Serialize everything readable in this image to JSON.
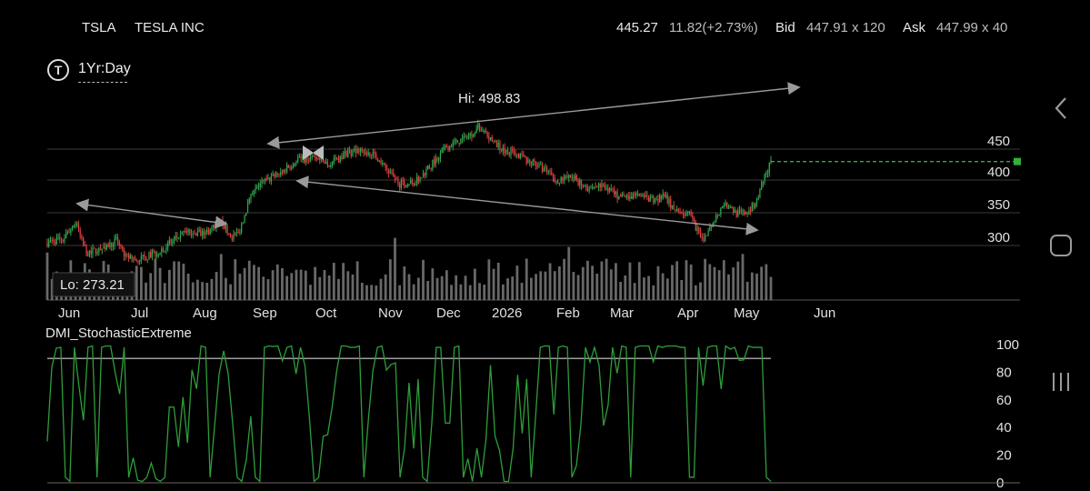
{
  "header": {
    "symbol": "TSLA",
    "company": "TESLA INC",
    "last": "445.27",
    "change": "11.82(+2.73%)",
    "bid_label": "Bid",
    "bid": "447.91 x 120",
    "ask_label": "Ask",
    "ask": "447.99 x 40"
  },
  "range_selector": {
    "icon": "T",
    "label": "1Yr:Day"
  },
  "colors": {
    "up": "#2fa84f",
    "down": "#e0403f",
    "volume": "#7a7a7a",
    "grid": "#3a3a3a",
    "trendline": "#9a9a9a",
    "stoch": "#2e9e3a",
    "last_price_line": "#2fb13a"
  },
  "chart_data": [
    {
      "type": "candlestick",
      "x_labels": [
        "Jun",
        "Jul",
        "Aug",
        "Sep",
        "Oct",
        "Nov",
        "Dec",
        "2026",
        "Feb",
        "Mar",
        "Apr",
        "May",
        "Jun"
      ],
      "y_ticks": [
        "450",
        "400",
        "350",
        "300"
      ],
      "ylim": [
        262,
        505
      ],
      "annotations": {
        "high": "Hi: 498.83",
        "low": "Lo: 273.21"
      },
      "last_price": 445.27,
      "anchors": [
        [
          0,
          338
        ],
        [
          10,
          343
        ],
        [
          18,
          365
        ],
        [
          25,
          325
        ],
        [
          35,
          330
        ],
        [
          45,
          342
        ],
        [
          50,
          318
        ],
        [
          58,
          315
        ],
        [
          70,
          325
        ],
        [
          80,
          340
        ],
        [
          88,
          352
        ],
        [
          100,
          350
        ],
        [
          112,
          365
        ],
        [
          117,
          345
        ],
        [
          122,
          350
        ],
        [
          132,
          412
        ],
        [
          140,
          420
        ],
        [
          150,
          432
        ],
        [
          160,
          448
        ],
        [
          170,
          450
        ],
        [
          180,
          440
        ],
        [
          190,
          455
        ],
        [
          200,
          462
        ],
        [
          210,
          452
        ],
        [
          215,
          438
        ],
        [
          225,
          415
        ],
        [
          235,
          418
        ],
        [
          245,
          440
        ],
        [
          255,
          465
        ],
        [
          265,
          474
        ],
        [
          270,
          480
        ],
        [
          275,
          492
        ],
        [
          282,
          475
        ],
        [
          292,
          460
        ],
        [
          302,
          452
        ],
        [
          315,
          438
        ],
        [
          325,
          420
        ],
        [
          335,
          425
        ],
        [
          345,
          410
        ],
        [
          355,
          415
        ],
        [
          365,
          398
        ],
        [
          375,
          400
        ],
        [
          385,
          395
        ],
        [
          395,
          398
        ],
        [
          400,
          382
        ],
        [
          410,
          375
        ],
        [
          418,
          340
        ],
        [
          425,
          365
        ],
        [
          432,
          390
        ],
        [
          440,
          376
        ],
        [
          447,
          378
        ],
        [
          452,
          390
        ],
        [
          458,
          425
        ],
        [
          462,
          445
        ]
      ]
    },
    {
      "type": "line",
      "title": "DMI_StochasticExtreme",
      "y_ticks": [
        "100",
        "80",
        "60",
        "40",
        "20",
        "0"
      ],
      "ylim": [
        0,
        100
      ],
      "levels": [
        90
      ]
    }
  ]
}
